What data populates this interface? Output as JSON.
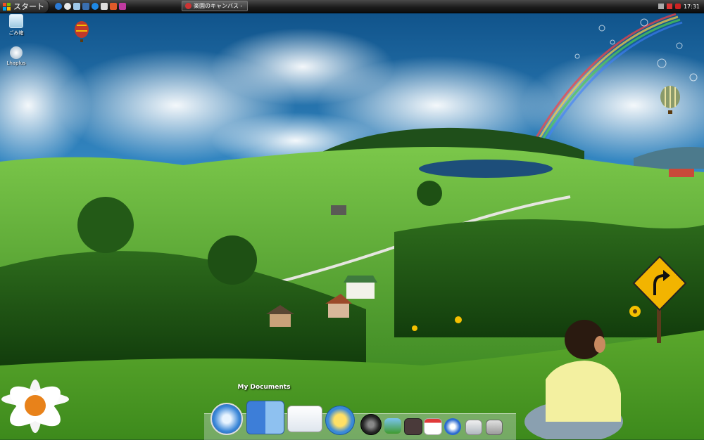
{
  "taskbar": {
    "start_label": "スタート",
    "task_window_title": "楽園のキャンバス -",
    "clock": "17:31",
    "quick_launch_icons": [
      "ie-icon",
      "chrome-icon",
      "folder-icon",
      "media-icon",
      "ie-icon",
      "notepad-icon",
      "paint-icon",
      "game-icon"
    ],
    "tray_icons": [
      "network-icon",
      "volume-icon",
      "antivirus-icon"
    ]
  },
  "desktop": {
    "icons": [
      {
        "label": "ごみ箱",
        "icon": "recycle-bin-icon"
      },
      {
        "label": "Lhaplus",
        "icon": "lhaplus-icon"
      }
    ]
  },
  "dock": {
    "hover_label": "My Documents",
    "items": [
      "safari-icon",
      "finder-icon",
      "mail-icon",
      "ichat-icon",
      "itunes-icon",
      "iphoto-icon",
      "imovie-icon",
      "ical-icon",
      "quicktime-icon",
      "utilities-icon",
      "drive-icon"
    ]
  },
  "colors": {
    "taskbar": "#1a1a1a",
    "sky": "#4aa0d8",
    "grass": "#3f8f22",
    "road_sign": "#f2b400"
  }
}
